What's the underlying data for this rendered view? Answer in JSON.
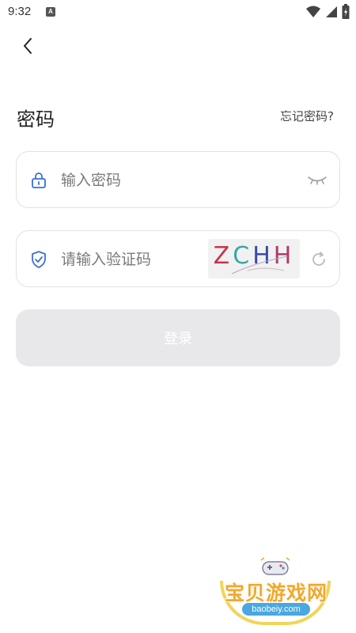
{
  "status_bar": {
    "time": "9:32",
    "notification_icon": "a-icon",
    "wifi_icon": "wifi-icon",
    "signal_icon": "signal-icon",
    "battery_icon": "battery-icon"
  },
  "nav": {
    "back_icon": "chevron-left-icon"
  },
  "header": {
    "title": "密码",
    "forgot_link": "忘记密码?"
  },
  "password_field": {
    "icon": "lock-icon",
    "value": "",
    "placeholder": "输入密码",
    "toggle_icon": "eye-closed-icon"
  },
  "captcha_field": {
    "icon": "shield-check-icon",
    "value": "",
    "placeholder": "请输入验证码",
    "captcha_text": [
      "Z",
      "C",
      "H",
      "H"
    ],
    "refresh_icon": "refresh-icon"
  },
  "login_button": {
    "label": "登录",
    "enabled": false
  },
  "watermark": {
    "text": "宝贝游戏网",
    "url": "baobeiy.com"
  },
  "colors": {
    "accent": "#3b6fd8",
    "button_disabled": "#e8e8ea",
    "border": "#e2e2e6",
    "watermark_orange": "#f0a92b",
    "watermark_blue": "#4aa7e0"
  }
}
